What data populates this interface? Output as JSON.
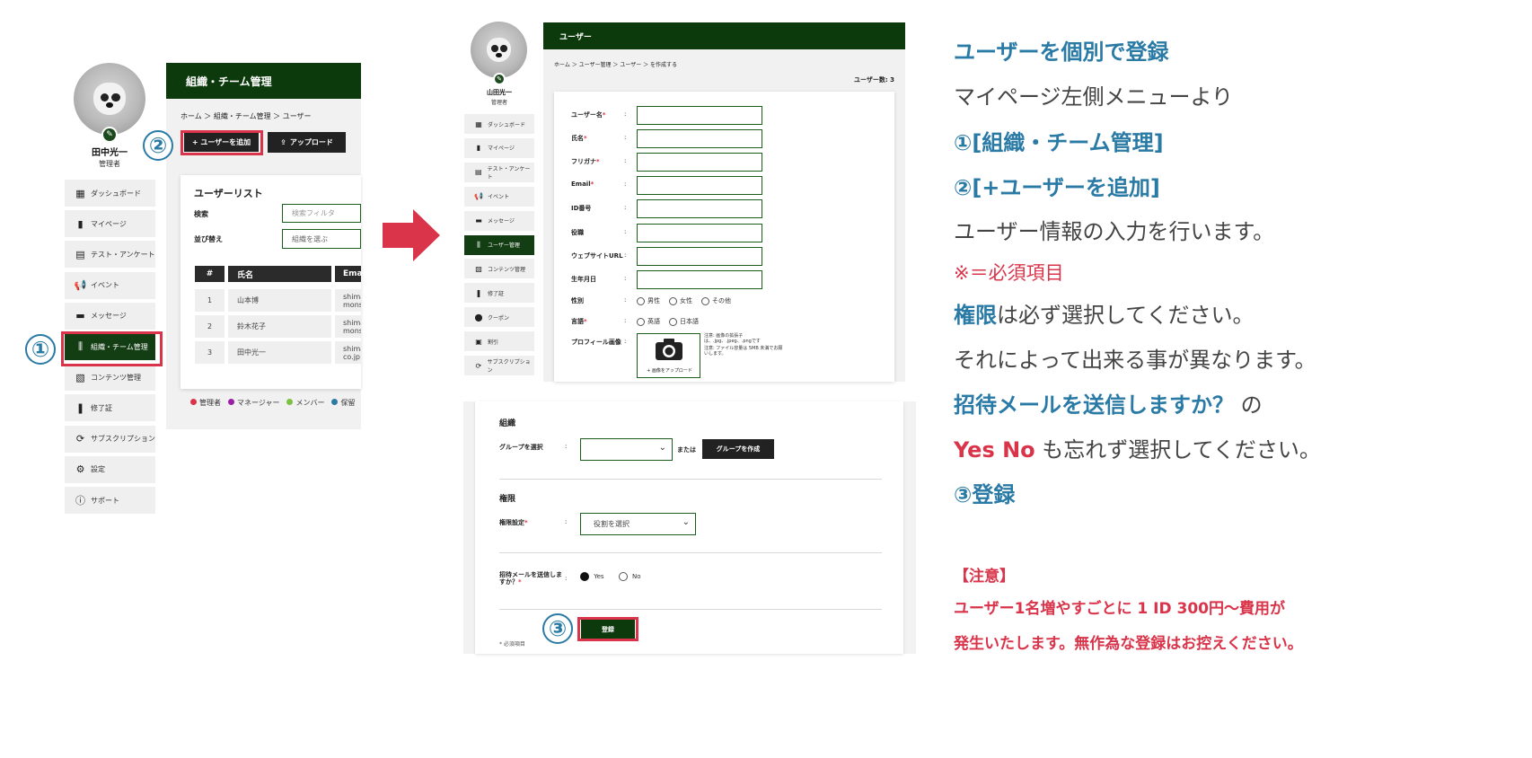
{
  "left": {
    "user": {
      "name": "田中光一",
      "role": "管理者"
    },
    "menu": [
      {
        "label": "ダッシュボード",
        "icon": "dashboard-icon"
      },
      {
        "label": "マイページ",
        "icon": "book-icon"
      },
      {
        "label": "テスト・アンケート",
        "icon": "test-icon"
      },
      {
        "label": "イベント",
        "icon": "megaphone-icon"
      },
      {
        "label": "メッセージ",
        "icon": "message-icon"
      },
      {
        "label": "組織・チーム管理",
        "icon": "team-icon"
      },
      {
        "label": "コンテンツ管理",
        "icon": "content-icon"
      },
      {
        "label": "修了証",
        "icon": "medal-icon"
      },
      {
        "label": "サブスクリプション",
        "icon": "subscription-icon"
      },
      {
        "label": "設定",
        "icon": "gear-icon"
      },
      {
        "label": "サポート",
        "icon": "info-icon"
      }
    ],
    "header_title": "組織・チーム管理",
    "breadcrumb": "ホーム ＞ 組織・チーム管理 ＞ ユーザー",
    "add_user_button": "+ ユーザーを追加",
    "upload_button": "アップロード",
    "user_list": {
      "title": "ユーザーリスト",
      "search_label": "検索",
      "search_placeholder": "検索フィルタ",
      "sort_label": "並び替え",
      "sort_placeholder": "組織を選ぶ",
      "columns": [
        "#",
        "氏名",
        "Ema"
      ],
      "rows": [
        {
          "no": "1",
          "name": "山本博",
          "email_1": "shima",
          "email_2": "mons"
        },
        {
          "no": "2",
          "name": "鈴木花子",
          "email_1": "shima",
          "email_2": "mons"
        },
        {
          "no": "3",
          "name": "田中光一",
          "email_1": "shima",
          "email_2": "co.jp"
        }
      ]
    },
    "legend": [
      {
        "label": "管理者",
        "color": "#d9344a"
      },
      {
        "label": "マネージャー",
        "color": "#9b1fa8"
      },
      {
        "label": "メンバー",
        "color": "#7cc241"
      },
      {
        "label": "保留",
        "color": "#2a7aa6"
      }
    ],
    "markers": {
      "one": "①",
      "two": "②"
    }
  },
  "center": {
    "user": {
      "name": "山田光一",
      "role": "管理者"
    },
    "menu": [
      {
        "label": "ダッシュボード",
        "icon": "dashboard-icon"
      },
      {
        "label": "マイページ",
        "icon": "book-icon"
      },
      {
        "label": "テスト・アンケート",
        "icon": "test-icon"
      },
      {
        "label": "イベント",
        "icon": "megaphone-icon"
      },
      {
        "label": "メッセージ",
        "icon": "message-icon"
      },
      {
        "label": "ユーザー管理",
        "icon": "team-icon"
      },
      {
        "label": "コンテンツ管理",
        "icon": "content-icon"
      },
      {
        "label": "修了証",
        "icon": "medal-icon"
      },
      {
        "label": "クーポン",
        "icon": "coupon-icon"
      },
      {
        "label": "割引",
        "icon": "discount-icon"
      },
      {
        "label": "サブスクリプション",
        "icon": "subscription-icon"
      }
    ],
    "header_title": "ユーザー",
    "breadcrumb": "ホーム ＞ ユーザー管理 ＞ ユーザー ＞ を作成する",
    "user_count": "ユーザー数: 3",
    "fields": [
      {
        "label": "ユーザー名",
        "required": "*"
      },
      {
        "label": "氏名",
        "required": "*"
      },
      {
        "label": "フリガナ",
        "required": "*"
      },
      {
        "label": "Email",
        "required": "*"
      },
      {
        "label": "ID番号",
        "required": ""
      },
      {
        "label": "役職",
        "required": ""
      },
      {
        "label": "ウェブサイトURL",
        "required": ""
      },
      {
        "label": "生年月日",
        "required": ""
      }
    ],
    "gender": {
      "label": "性別",
      "options": [
        "男性",
        "女性",
        "その他"
      ]
    },
    "language": {
      "label": "言語",
      "required": "*",
      "options": [
        "英語",
        "日本語"
      ]
    },
    "profile": {
      "label": "プロフィール画像",
      "upload_label": "+ 画像をアップロード",
      "note_1": "注意: 画像の拡張子は、.jpg、.jpeg、.pngです",
      "note_2": "注意: ファイル容量は 5MB 未満でお願いします。"
    },
    "org": {
      "section": "組織",
      "group_label": "グループを選択",
      "or_text": "または",
      "create_group_button": "グループを作成"
    },
    "permission": {
      "section": "権限",
      "label": "権限設定",
      "required": "*",
      "placeholder": "役割を選択"
    },
    "invite": {
      "label": "招待メールを送信しますか？",
      "required": "*",
      "yes": "Yes",
      "no": "No"
    },
    "submit_button": "登録",
    "required_note": "* 必須項目",
    "colon": ":",
    "marker_three": "③"
  },
  "right": {
    "title": "ユーザーを個別で登録",
    "line_1": "マイページ左側メニューより",
    "step_1": "①[組織・チーム管理]",
    "step_2": "②[+ユーザーを追加]",
    "line_2": "ユーザー情報の入力を行います。",
    "required_note": "※＝必須項目",
    "perm_bold": "権限",
    "perm_rest": "は必ず選択してください。",
    "line_3": "それによって出来る事が異なります。",
    "invite_bold": "招待メールを送信しますか？",
    "invite_rest": " の",
    "yesno_bold": "Yes No",
    "yesno_rest": " も忘れず選択してください。",
    "step_3": "③登録",
    "caution_title": "【注意】",
    "caution_1": "ユーザー1名増やすごとに 1 ID 300円～費用が",
    "caution_2": "発生いたします。無作為な登録はお控えください。"
  },
  "colors": {
    "green": "#0c3a0c",
    "accent_red": "#d9344a",
    "accent_blue": "#2a7aa6"
  }
}
